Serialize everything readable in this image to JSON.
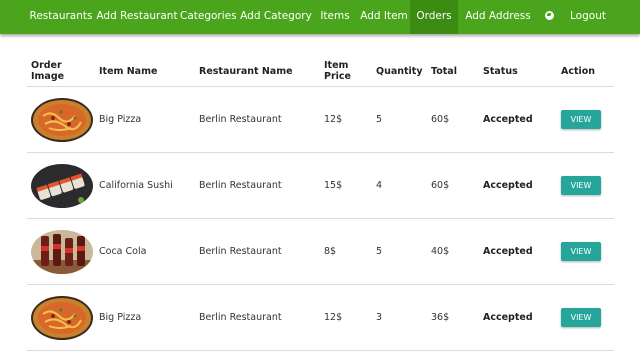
{
  "nav": {
    "items": [
      {
        "label": "Restaurants"
      },
      {
        "label": "Add Restaurant"
      },
      {
        "label": "Categories"
      },
      {
        "label": "Add Category"
      },
      {
        "label": "Items"
      },
      {
        "label": "Add Item"
      },
      {
        "label": "Orders",
        "active": true
      },
      {
        "label": "Add Address"
      },
      {
        "label": "Logout"
      }
    ],
    "globe_icon": "globe-icon",
    "bar_color": "#4aa51c",
    "active_color": "#3c8c14"
  },
  "table": {
    "headers": [
      "Order Image",
      "Item Name",
      "Restaurant Name",
      "Item Price",
      "Quantity",
      "Total",
      "Status",
      "Action"
    ],
    "rows": [
      {
        "image": "pizza",
        "item": "Big Pizza",
        "restaurant": "Berlin Restaurant",
        "price": "12$",
        "quantity": "5",
        "total": "60$",
        "status": "Accepted",
        "action": "VIEW"
      },
      {
        "image": "sushi",
        "item": "California Sushi",
        "restaurant": "Berlin Restaurant",
        "price": "15$",
        "quantity": "4",
        "total": "60$",
        "status": "Accepted",
        "action": "VIEW"
      },
      {
        "image": "cola",
        "item": "Coca Cola",
        "restaurant": "Berlin Restaurant",
        "price": "8$",
        "quantity": "5",
        "total": "40$",
        "status": "Accepted",
        "action": "VIEW"
      },
      {
        "image": "pizza",
        "item": "Big Pizza",
        "restaurant": "Berlin Restaurant",
        "price": "12$",
        "quantity": "3",
        "total": "36$",
        "status": "Accepted",
        "action": "VIEW"
      }
    ],
    "button_color": "#26a69a"
  }
}
